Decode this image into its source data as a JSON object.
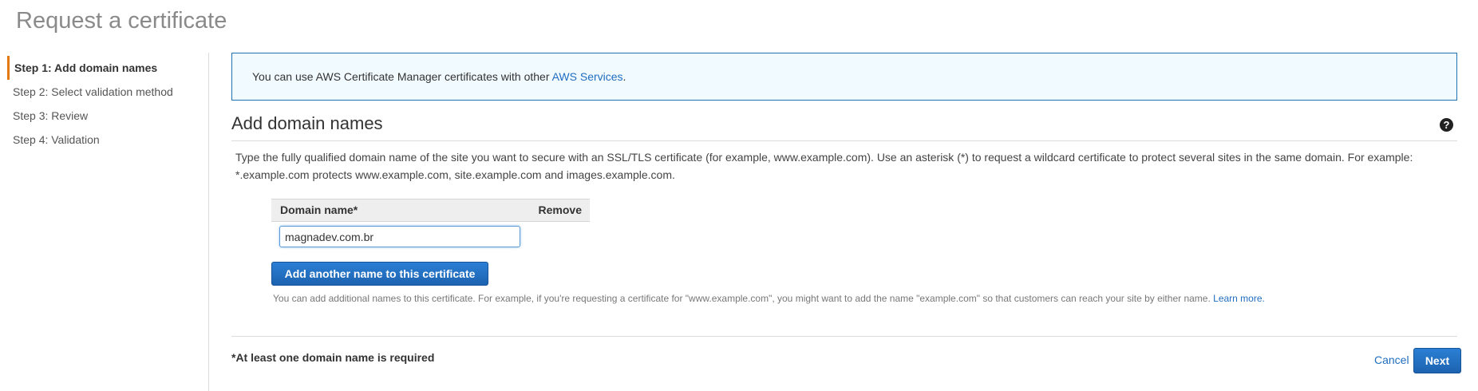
{
  "page": {
    "title": "Request a certificate"
  },
  "steps": [
    {
      "label": "Step 1: Add domain names",
      "active": true
    },
    {
      "label": "Step 2: Select validation method",
      "active": false
    },
    {
      "label": "Step 3: Review",
      "active": false
    },
    {
      "label": "Step 4: Validation",
      "active": false
    }
  ],
  "info": {
    "text": "You can use AWS Certificate Manager certificates with other ",
    "link": "AWS Services",
    "suffix": "."
  },
  "section": {
    "heading": "Add domain names",
    "help_icon": "question-circle-icon",
    "description": "Type the fully qualified domain name of the site you want to secure with an SSL/TLS certificate (for example, www.example.com). Use an asterisk (*) to request a wildcard certificate to protect several sites in the same domain. For example: *.example.com protects www.example.com, site.example.com and images.example.com."
  },
  "table": {
    "headers": {
      "domain": "Domain name*",
      "remove": "Remove"
    },
    "rows": [
      {
        "domain": "magnadev.com.br"
      }
    ]
  },
  "add_button": {
    "label": "Add another name to this certificate"
  },
  "help_text": {
    "text": "You can add additional names to this certificate. For example, if you're requesting a certificate for \"www.example.com\", you might want to add the name \"example.com\" so that customers can reach your site by either name. ",
    "link": "Learn more."
  },
  "footer": {
    "required_note": "*At least one domain name is required",
    "cancel": "Cancel",
    "next": "Next"
  },
  "colors": {
    "accent": "#e47911",
    "link": "#1f6ebf",
    "primary_button": "#1d63b0",
    "info_border": "#1e73b4"
  }
}
